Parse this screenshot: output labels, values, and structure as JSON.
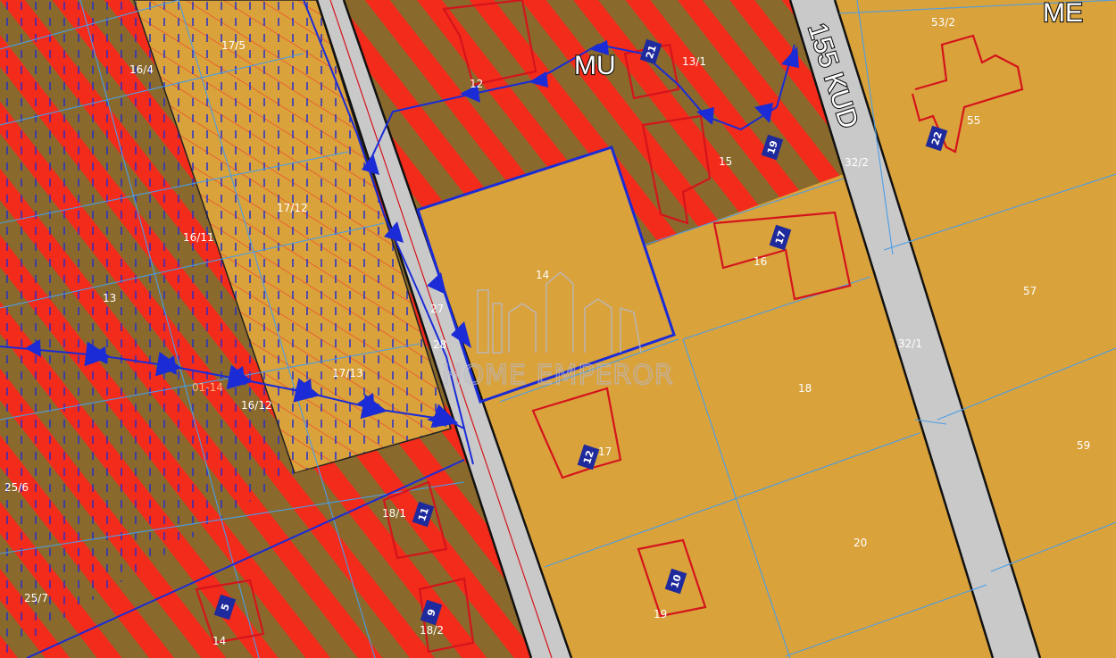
{
  "map": {
    "zones": {
      "mu_label": "MU",
      "me_label": "ME"
    },
    "road_label": "155 KUD",
    "watermark": "HOME EMPEROR",
    "colors": {
      "plot_fill": "#d9a23b",
      "mixed_use_stripe_red": "#f22b1b",
      "mixed_use_stripe_brown": "#8a6a2c",
      "road_fill": "#c9c9c9",
      "building_outline": "#d4141c",
      "boundary_blue": "#1b2bd6",
      "parcel_line": "#4a9de8",
      "building_number_bg": "#1f2a9c"
    },
    "plot_labels": [
      {
        "id": "p-17-5",
        "text": "17/5"
      },
      {
        "id": "p-16-4",
        "text": "16/4"
      },
      {
        "id": "p-17-12",
        "text": "17/12"
      },
      {
        "id": "p-16-11",
        "text": "16/11"
      },
      {
        "id": "p-13-left",
        "text": "13"
      },
      {
        "id": "p-01-14",
        "text": "01-14"
      },
      {
        "id": "p-16-12",
        "text": "16/12"
      },
      {
        "id": "p-17-13",
        "text": "17/13"
      },
      {
        "id": "p-25-6",
        "text": "25/6"
      },
      {
        "id": "p-25-7",
        "text": "25/7"
      },
      {
        "id": "p-14-bottom",
        "text": "14"
      },
      {
        "id": "p-18-1",
        "text": "18/1"
      },
      {
        "id": "p-18-2",
        "text": "18/2"
      },
      {
        "id": "p-12",
        "text": "12"
      },
      {
        "id": "p-13-1",
        "text": "13/1"
      },
      {
        "id": "p-15",
        "text": "15"
      },
      {
        "id": "p-14",
        "text": "14"
      },
      {
        "id": "p-27",
        "text": "27"
      },
      {
        "id": "p-28",
        "text": "28"
      },
      {
        "id": "p-16",
        "text": "16"
      },
      {
        "id": "p-17",
        "text": "17"
      },
      {
        "id": "p-18",
        "text": "18"
      },
      {
        "id": "p-19",
        "text": "19"
      },
      {
        "id": "p-20",
        "text": "20"
      },
      {
        "id": "p-53-2",
        "text": "53/2"
      },
      {
        "id": "p-55",
        "text": "55"
      },
      {
        "id": "p-32-2",
        "text": "32/2"
      },
      {
        "id": "p-57",
        "text": "57"
      },
      {
        "id": "p-32-1",
        "text": "32/1"
      },
      {
        "id": "p-59",
        "text": "59"
      }
    ],
    "building_numbers": [
      {
        "id": "b-21",
        "text": "21"
      },
      {
        "id": "b-19",
        "text": "19"
      },
      {
        "id": "b-22",
        "text": "22"
      },
      {
        "id": "b-17",
        "text": "17"
      },
      {
        "id": "b-12",
        "text": "12"
      },
      {
        "id": "b-11",
        "text": "11"
      },
      {
        "id": "b-10",
        "text": "10"
      },
      {
        "id": "b-9",
        "text": "9"
      },
      {
        "id": "b-5",
        "text": "5"
      }
    ]
  }
}
